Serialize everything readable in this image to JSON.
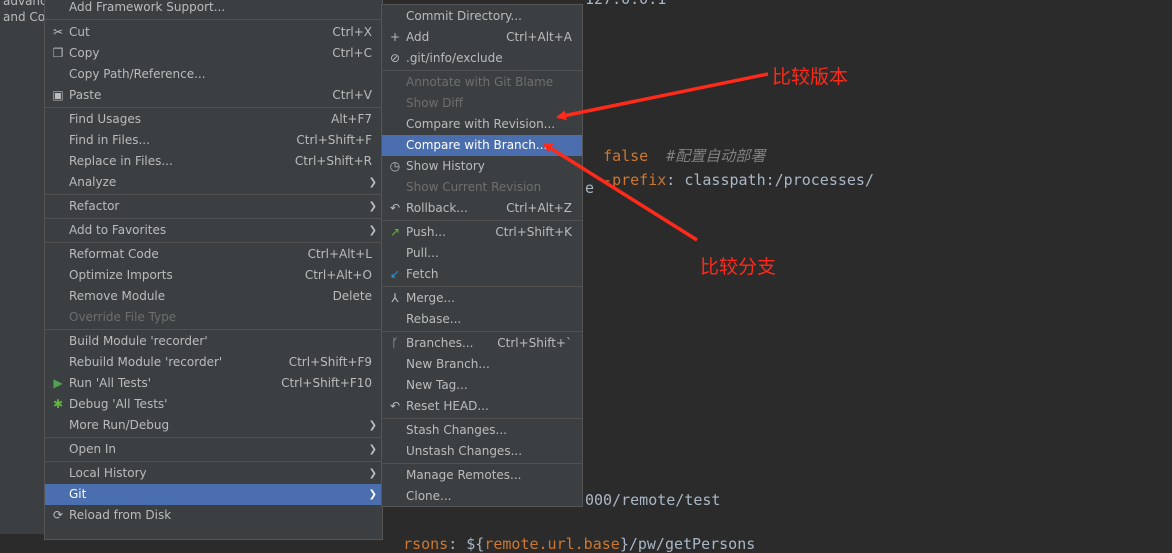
{
  "left_strip": {
    "line1": "advance",
    "line2": "and Co"
  },
  "code": {
    "line0": "127.0.0.1",
    "line1_value": "false",
    "line1_comment": "#配置自动部署",
    "line2_key": "-prefix",
    "line2_rest": ": classpath:/processes/",
    "line3": "e",
    "line4": "000/remote/test",
    "line5_key": "rsons",
    "line5_sep": ": ${",
    "line5_var": "remote.url.base",
    "line5_rest": "}/pw/getPersons"
  },
  "main_menu": {
    "items": [
      {
        "label": "Add Framework Support..."
      },
      {
        "label": "Cut",
        "shortcut": "Ctrl+X"
      },
      {
        "label": "Copy",
        "shortcut": "Ctrl+C"
      },
      {
        "label": "Copy Path/Reference..."
      },
      {
        "label": "Paste",
        "shortcut": "Ctrl+V"
      },
      {
        "label": "Find Usages",
        "shortcut": "Alt+F7"
      },
      {
        "label": "Find in Files...",
        "shortcut": "Ctrl+Shift+F"
      },
      {
        "label": "Replace in Files...",
        "shortcut": "Ctrl+Shift+R"
      },
      {
        "label": "Analyze"
      },
      {
        "label": "Refactor"
      },
      {
        "label": "Add to Favorites"
      },
      {
        "label": "Reformat Code",
        "shortcut": "Ctrl+Alt+L"
      },
      {
        "label": "Optimize Imports",
        "shortcut": "Ctrl+Alt+O"
      },
      {
        "label": "Remove Module",
        "shortcut": "Delete"
      },
      {
        "label": "Override File Type"
      },
      {
        "label": "Build Module 'recorder'"
      },
      {
        "label": "Rebuild Module 'recorder'",
        "shortcut": "Ctrl+Shift+F9"
      },
      {
        "label": "Run 'All Tests'",
        "shortcut": "Ctrl+Shift+F10"
      },
      {
        "label": "Debug 'All Tests'"
      },
      {
        "label": "More Run/Debug"
      },
      {
        "label": "Open In"
      },
      {
        "label": "Local History"
      },
      {
        "label": "Git"
      },
      {
        "label": "Reload from Disk"
      }
    ]
  },
  "git_menu": {
    "items": [
      {
        "label": "Commit Directory..."
      },
      {
        "label": "Add",
        "shortcut": "Ctrl+Alt+A"
      },
      {
        "label": ".git/info/exclude"
      },
      {
        "label": "Annotate with Git Blame"
      },
      {
        "label": "Show Diff"
      },
      {
        "label": "Compare with Revision..."
      },
      {
        "label": "Compare with Branch..."
      },
      {
        "label": "Show History"
      },
      {
        "label": "Show Current Revision"
      },
      {
        "label": "Rollback...",
        "shortcut": "Ctrl+Alt+Z"
      },
      {
        "label": "Push...",
        "shortcut": "Ctrl+Shift+K"
      },
      {
        "label": "Pull..."
      },
      {
        "label": "Fetch"
      },
      {
        "label": "Merge..."
      },
      {
        "label": "Rebase..."
      },
      {
        "label": "Branches...",
        "shortcut": "Ctrl+Shift+`"
      },
      {
        "label": "New Branch..."
      },
      {
        "label": "New Tag..."
      },
      {
        "label": "Reset HEAD..."
      },
      {
        "label": "Stash Changes..."
      },
      {
        "label": "Unstash Changes..."
      },
      {
        "label": "Manage Remotes..."
      },
      {
        "label": "Clone..."
      }
    ]
  },
  "annotations": {
    "compare_version": "比较版本",
    "compare_branch": "比较分支"
  },
  "colors": {
    "selection": "#4b6eaf",
    "menu_bg": "#3c3f41",
    "annotation": "#ff2a1a",
    "disabled_text": "#6e6e6e"
  },
  "icons": [
    "scissors-icon",
    "copy-icon",
    "paste-icon",
    "run-icon",
    "debug-icon",
    "reload-icon",
    "plus-icon",
    "exclude-file-icon",
    "clock-icon",
    "rollback-icon",
    "push-icon",
    "fetch-icon",
    "merge-icon",
    "branch-icon",
    "reset-icon"
  ]
}
